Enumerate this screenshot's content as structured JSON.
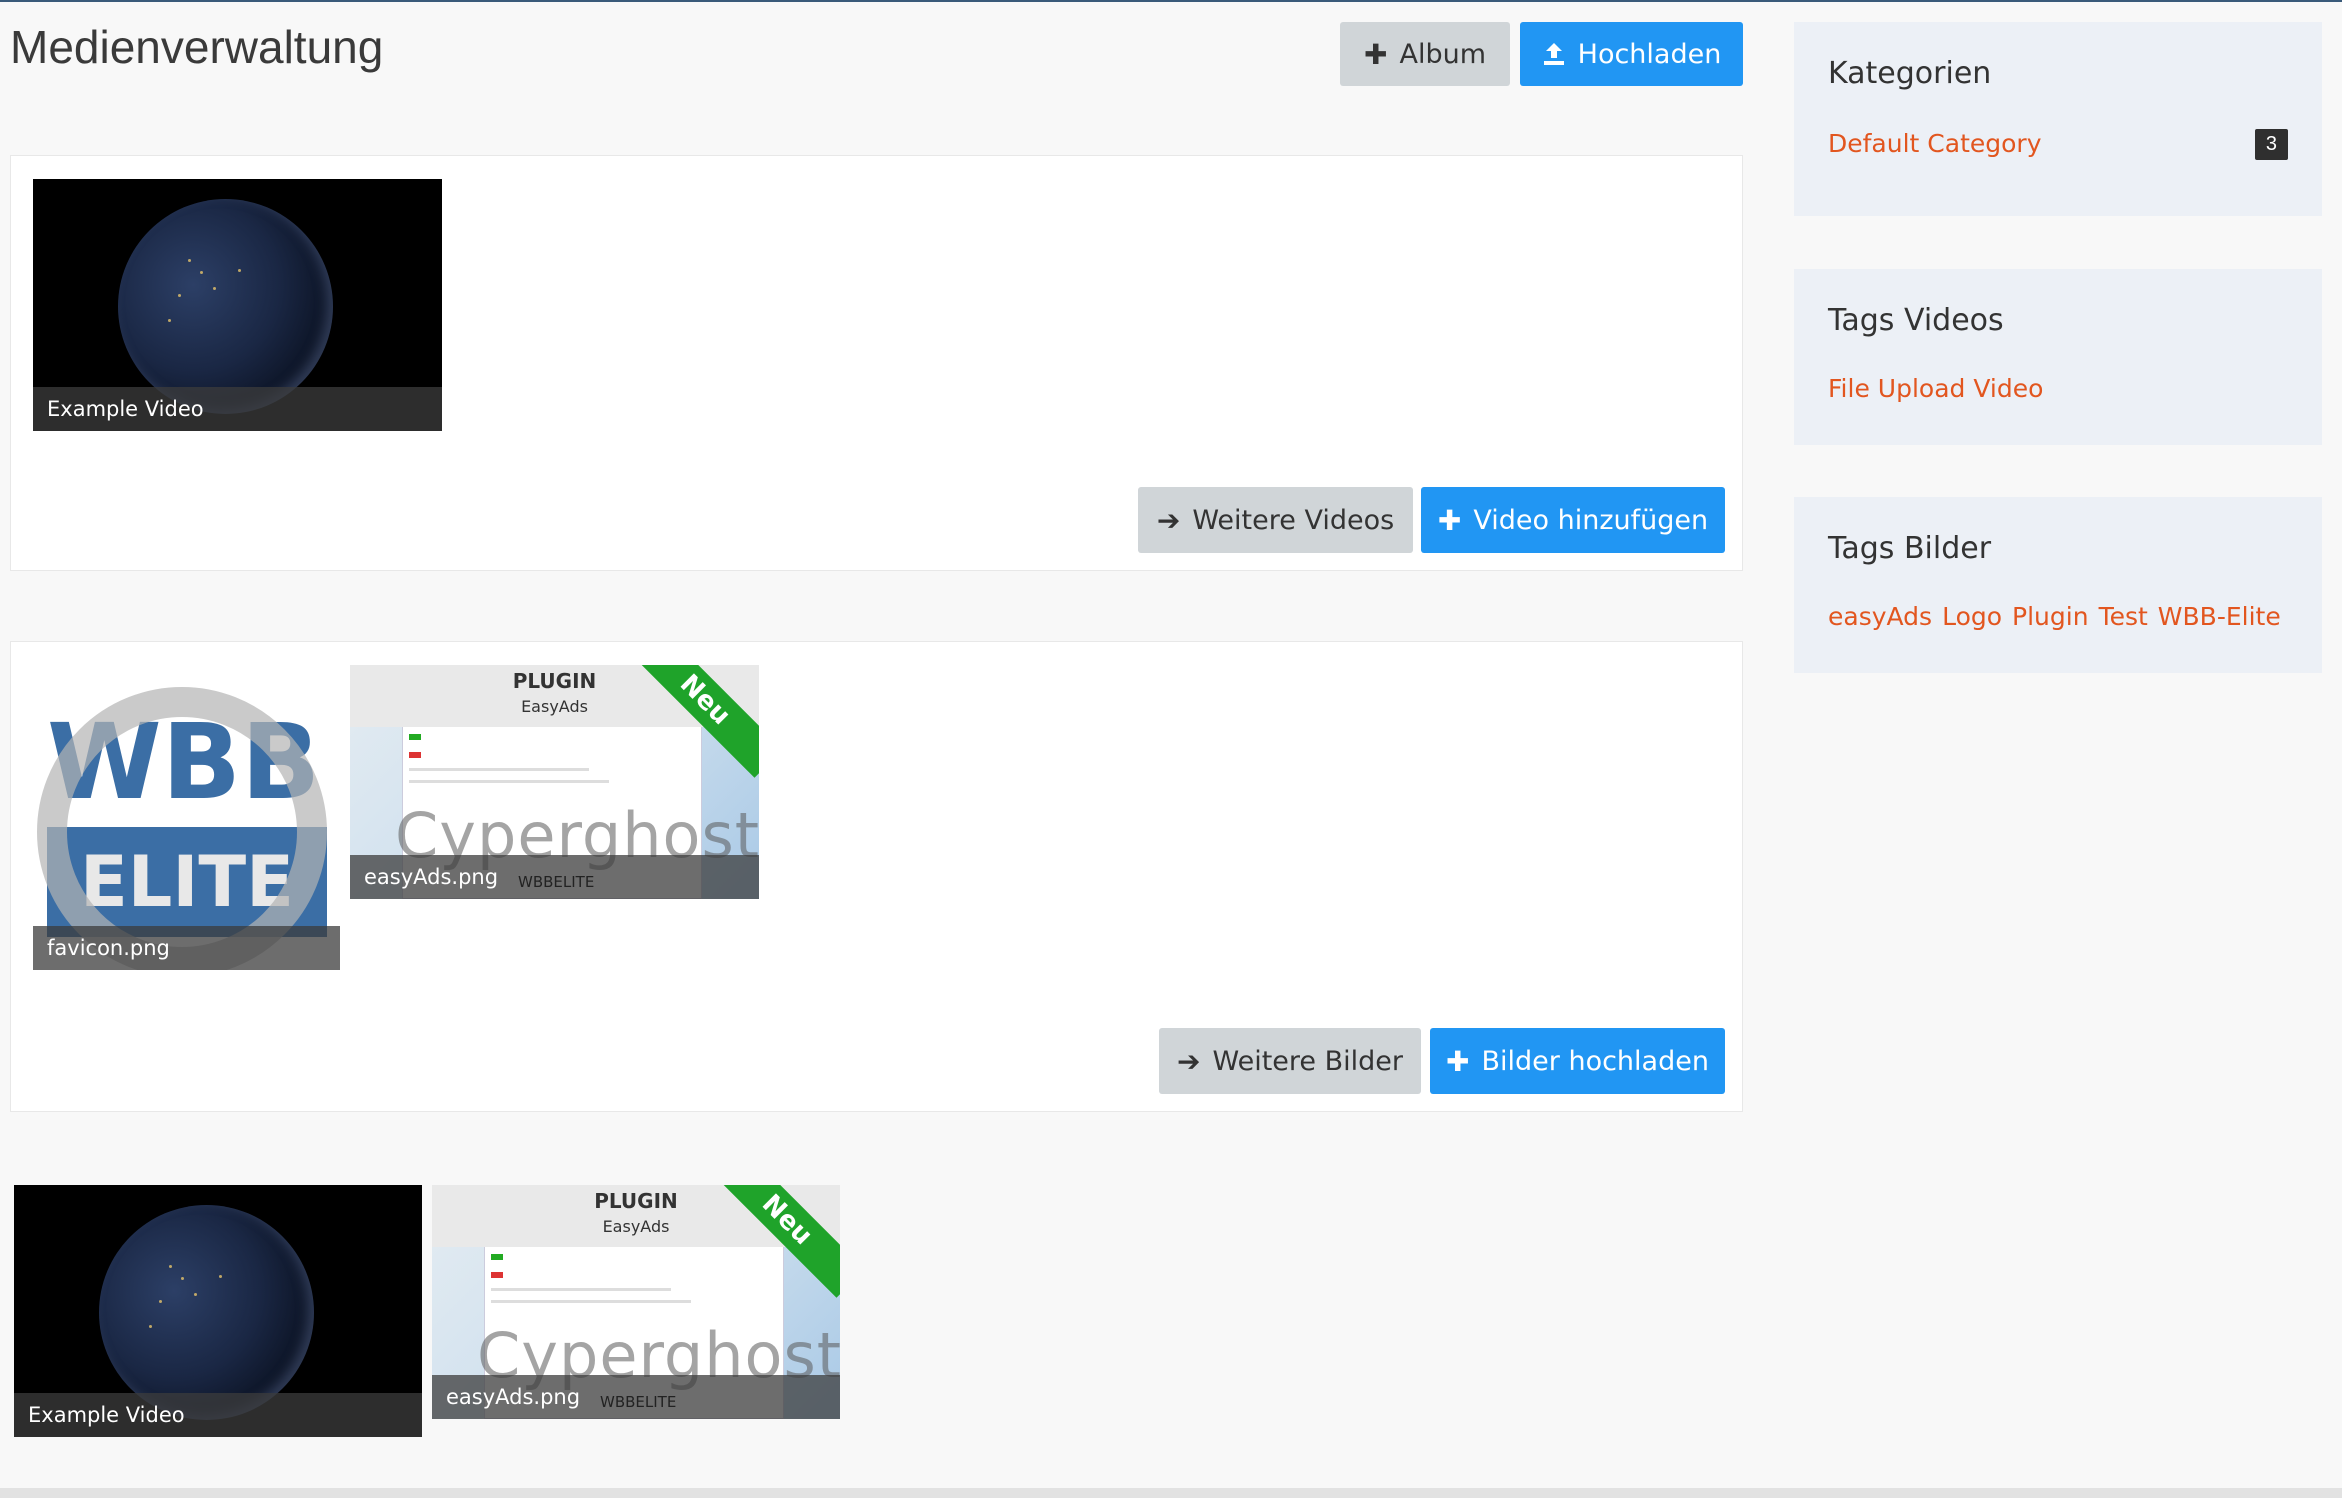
{
  "page": {
    "title": "Medienverwaltung"
  },
  "header": {
    "album_label": "Album",
    "upload_label": "Hochladen"
  },
  "videos_panel": {
    "items": [
      {
        "caption": "Example Video"
      }
    ],
    "more_label": "Weitere Videos",
    "add_label": "Video hinzufügen"
  },
  "images_panel": {
    "items": [
      {
        "caption": "favicon.png"
      },
      {
        "caption": "easyAds.png"
      }
    ],
    "more_label": "Weitere Bilder",
    "add_label": "Bilder hochladen"
  },
  "album_row": {
    "items": [
      {
        "caption": "Example Video"
      },
      {
        "caption": "easyAds.png"
      }
    ]
  },
  "thumbnails": {
    "wbb_logo_top": "WBB",
    "wbb_logo_bottom": "ELITE",
    "plugin_heading": "PLUGIN",
    "plugin_name": "EasyAds",
    "ribbon": "Neu",
    "watermark": "Cyperghost",
    "footer_logo": "WBBELITE"
  },
  "sidebar": {
    "categories": {
      "title": "Kategorien",
      "items": [
        {
          "label": "Default Category",
          "count": "3"
        }
      ]
    },
    "tags_videos": {
      "title": "Tags Videos",
      "tags": [
        "File Upload Video"
      ]
    },
    "tags_images": {
      "title": "Tags Bilder",
      "tags": [
        "easyAds",
        "Logo",
        "Plugin",
        "Test",
        "WBB-Elite"
      ]
    }
  },
  "colors": {
    "accent": "#2196f3",
    "link": "#e2561f",
    "ribbon": "#1fa32a"
  },
  "icons": {
    "plus": "plus-icon",
    "upload": "upload-icon",
    "arrow": "arrow-right-icon"
  }
}
